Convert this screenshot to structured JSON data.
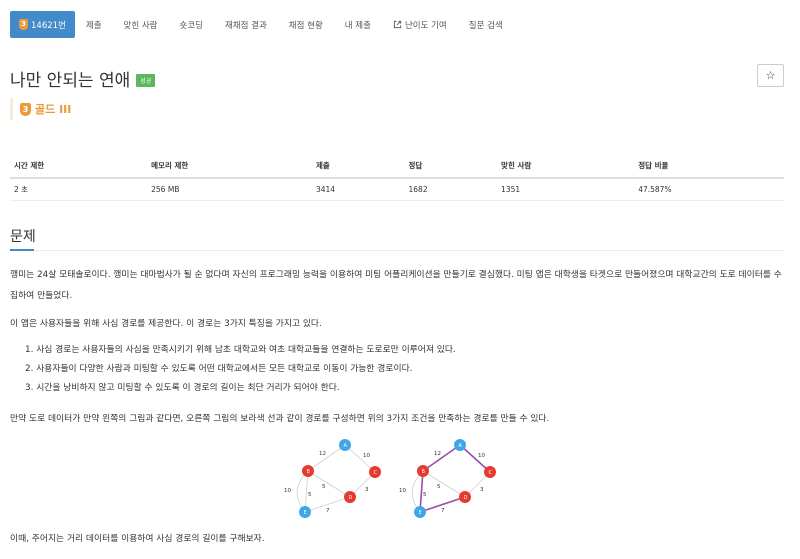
{
  "tabs": [
    {
      "label": "14621번",
      "active": true,
      "tier_number": "3"
    },
    {
      "label": "제출"
    },
    {
      "label": "맞힌 사람"
    },
    {
      "label": "숏코딩"
    },
    {
      "label": "재채점 결과"
    },
    {
      "label": "채점 현황"
    },
    {
      "label": "내 제출"
    },
    {
      "label": "난이도 기여",
      "icon": "external-link-icon"
    },
    {
      "label": "질문 검색"
    }
  ],
  "problem": {
    "title": "나만 안되는 연애",
    "status_badge": "성공",
    "tier_number": "3",
    "tier_label": "골드 III",
    "star_icon": "☆"
  },
  "info_table": {
    "headers": [
      "시간 제한",
      "메모리 제한",
      "제출",
      "정답",
      "맞힌 사람",
      "정답 비율"
    ],
    "values": [
      "2 초",
      "256 MB",
      "3414",
      "1682",
      "1351",
      "47.587%"
    ]
  },
  "section": {
    "title": "문제",
    "p1": "깽미는 24살 모태솔로이다. 깽미는 대마법사가 될 순 없다며 자신의 프로그래밍 능력을 이용하여 미팅 어플리케이션을 만들기로 결심했다. 미팅 앱은 대학생을 타겟으로 만들어졌으며 대학교간의 도로 데이터를 수집하여 만들었다.",
    "p2": "이 앱은 사용자들을 위해 사심 경로를 제공한다. 이 경로는 3가지 특징을 가지고 있다.",
    "list": [
      "1.  사심 경로는 사용자들의 사심을 만족시키기 위해 남초 대학교와 여초 대학교들을 연결하는 도로로만 이루어져 있다.",
      "2.  사용자들이 다양한 사람과 미팅할 수 있도록 어떤 대학교에서든 모든 대학교로 이동이 가능한 경로이다.",
      "3.  시간을 낭비하지 않고 미팅할 수 있도록 이 경로의 길이는 최단 거리가 되어야 한다."
    ],
    "p3": "만약 도로 데이터가 만약 왼쪽의 그림과 같다면, 오른쪽 그림의 보라색 선과 같이 경로를 구성하면 위의 3가지 조건을 만족하는 경로를 만들 수 있다.",
    "p4": "이때, 주어지는 거리 데이터를 이용하여 사심 경로의 길이를 구해보자."
  },
  "figure": {
    "nodes": [
      "A",
      "B",
      "C",
      "D",
      "E"
    ],
    "edge_weights": [
      "12",
      "10",
      "5",
      "3",
      "10",
      "5",
      "7"
    ],
    "colors": {
      "blue_node": "#3fa7e8",
      "red_node": "#e53a2f",
      "path": "#9b4bb0",
      "edge": "#cfcfcf"
    }
  },
  "colors": {
    "accent": "#428bca",
    "success": "#5cb85c",
    "gold": "#ec9a3b"
  }
}
